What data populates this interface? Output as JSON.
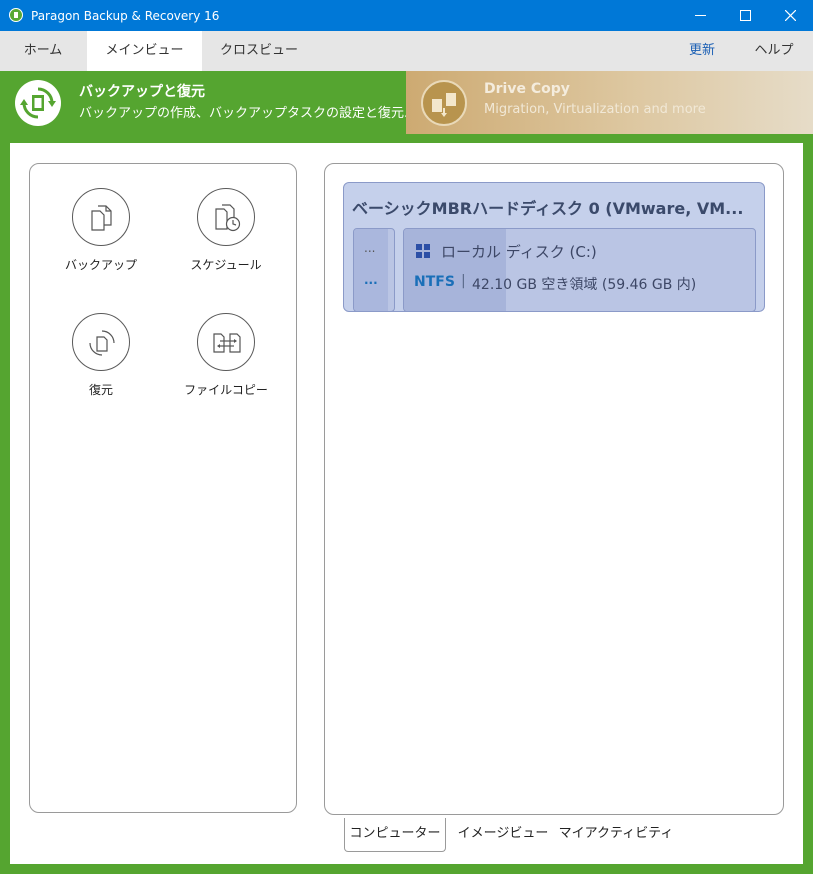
{
  "window": {
    "title": "Paragon Backup & Recovery 16",
    "controls": [
      "minimize-icon",
      "maximize-icon",
      "close-icon"
    ]
  },
  "tabs": {
    "items": [
      {
        "label": "ホーム"
      },
      {
        "label": "メインビュー",
        "active": true
      },
      {
        "label": "クロスビュー"
      }
    ],
    "refresh": "更新",
    "help": "ヘルプ"
  },
  "banners": {
    "backup": {
      "title": "バックアップと復元",
      "subtitle": "バックアップの作成、バックアップタスクの設定と復元...",
      "icon": "backup-restore-icon",
      "color": "#55a530"
    },
    "drive_copy": {
      "title": "Drive Copy",
      "subtitle": "Migration, Virtualization and more",
      "icon": "drive-copy-icon",
      "color": "#cdaa72"
    }
  },
  "tools": [
    {
      "label": "バックアップ",
      "icon": "backup-documents-icon"
    },
    {
      "label": "スケジュール",
      "icon": "schedule-icon"
    },
    {
      "label": "復元",
      "icon": "restore-icon"
    },
    {
      "label": "ファイルコピー",
      "icon": "file-copy-icon"
    }
  ],
  "disk": {
    "title": "ベーシックMBRハードディスク 0 (VMware, VM...",
    "small_partition": {
      "line1": "...",
      "line2": "..."
    },
    "partition": {
      "name": "ローカル ディスク (C:)",
      "fs": "NTFS",
      "separator": "|",
      "size_info": "42.10 GB 空き領域 (59.46 GB 内)",
      "used_fraction": 0.29
    }
  },
  "bottom_tabs": [
    {
      "label": "コンピューター",
      "active": true
    },
    {
      "label": "イメージビュー"
    },
    {
      "label": "マイアクティビティ"
    }
  ],
  "colors": {
    "titlebar": "#0078d7",
    "frame_green": "#55a530",
    "disk_blue": "#c5d0eb",
    "fs_blue": "#1a6fb8"
  }
}
